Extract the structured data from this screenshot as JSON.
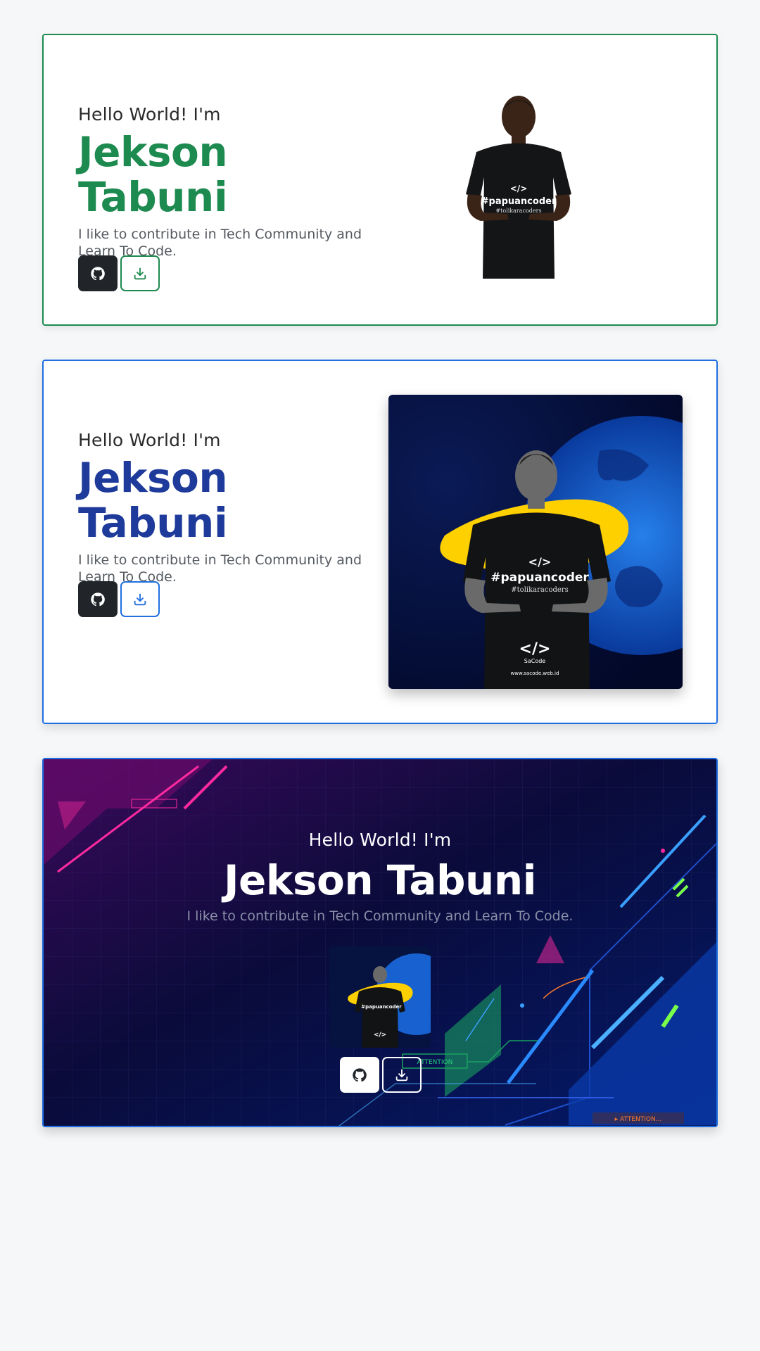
{
  "cards": [
    {
      "greeting": "Hello World! I'm",
      "name": "Jekson Tabuni",
      "bio": "I like to contribute in Tech Community and Learn To Code.",
      "name_color": "#1d8a4f",
      "border_color": "#1d8a4f"
    },
    {
      "greeting": "Hello World! I'm",
      "name": "Jekson Tabuni",
      "bio": "I like to contribute in Tech Community and Learn To Code.",
      "name_color": "#1e3a9a",
      "border_color": "#1f6fe0"
    },
    {
      "greeting": "Hello World! I'm",
      "name": "Jekson Tabuni",
      "bio": "I like to contribute in Tech Community and Learn To Code.",
      "name_color": "#ffffff",
      "border_color": "#1f6fe0"
    }
  ],
  "shirt": {
    "logo": "</>",
    "hashtag": "#papuancoder",
    "tagline": "#tolikaracoders"
  },
  "brand": {
    "logo": "</>",
    "name": "SaCode",
    "url": "www.sacode.web.id"
  },
  "background_labels": {
    "attention_1": "ATTENTION",
    "attention_2": "▸ ATTENTION..."
  },
  "icons": {
    "github": "github-icon",
    "download": "download-icon"
  }
}
